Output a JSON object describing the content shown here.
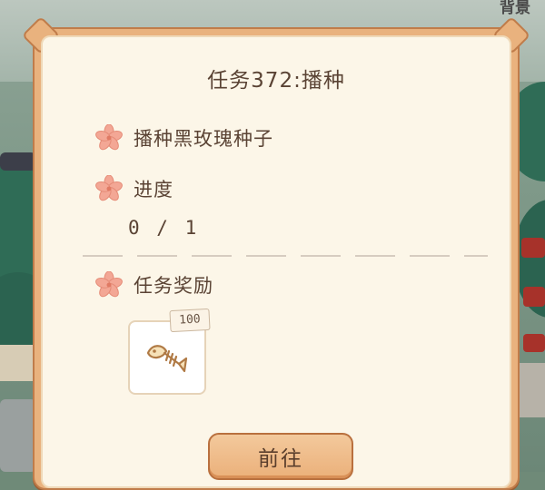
{
  "background": {
    "corner_text": "背景"
  },
  "quest": {
    "title": "任务372:播种",
    "objective_label": "播种黑玫瑰种子",
    "progress_label": "进度",
    "progress_value": "0 / 1",
    "progress_current": 0,
    "progress_total": 1,
    "reward_label": "任务奖励",
    "reward": {
      "icon": "fish-bone-icon",
      "quantity": "100"
    },
    "go_button_label": "前往"
  },
  "colors": {
    "panel_border": "#e9b27e",
    "panel_bg": "#fcf6e8",
    "text": "#5a4334",
    "flower": "#f3a795",
    "button": "#ebb07a"
  }
}
